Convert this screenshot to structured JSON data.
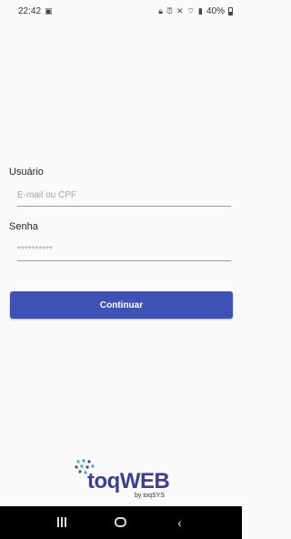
{
  "status_bar": {
    "time": "22:42",
    "battery": "40%"
  },
  "form": {
    "user_label": "Usuário",
    "user_placeholder": "E-mail ou CPF",
    "password_label": "Senha",
    "password_placeholder": "**********",
    "continue_label": "Continuar"
  },
  "logo": {
    "name": "toqWEB",
    "subtitle": "by toqSYS"
  },
  "colors": {
    "accent": "#3e51b5",
    "logo": "#3b3f8f",
    "background": "#fafafa"
  }
}
